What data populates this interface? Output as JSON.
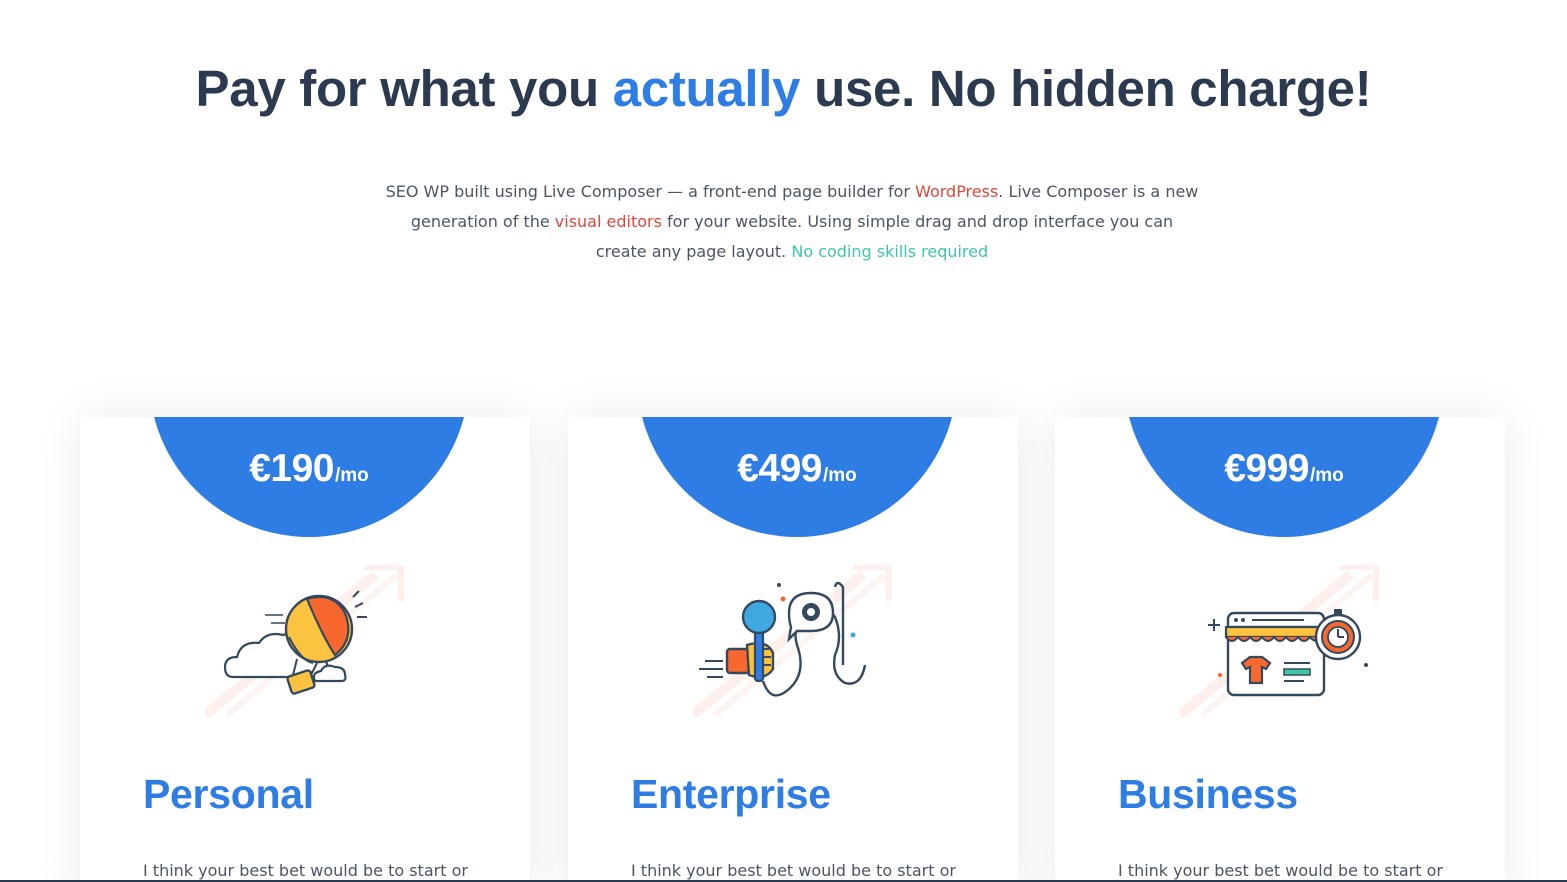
{
  "header": {
    "title_before": "Pay for what you",
    "title_accent": "actually",
    "title_after": "use. No hidden charge!"
  },
  "intro": {
    "part1": "SEO WP built using Live Composer — a front-end page builder for ",
    "link1": "WordPress",
    "part2": ". Live Composer is a new generation of the ",
    "link2": "visual editors",
    "part3": " for your website. Using simple drag and drop interface you can create any page layout. ",
    "link3": "No coding skills required"
  },
  "plans": [
    {
      "price": "€190",
      "period": "/mo",
      "name": "Personal",
      "illustration": "hot-air-balloon-illustration",
      "description": "I think your best bet would be to start or"
    },
    {
      "price": "€499",
      "period": "/mo",
      "name": "Enterprise",
      "illustration": "microphone-speech-illustration",
      "description": "I think your best bet would be to start or"
    },
    {
      "price": "€999",
      "period": "/mo",
      "name": "Business",
      "illustration": "online-store-clock-illustration",
      "description": "I think your best bet would be to start or"
    }
  ],
  "colors": {
    "accent": "#2d7de5",
    "heading": "#2b3a4f",
    "body_text": "#4b5566",
    "link_red": "#e0443a",
    "link_teal": "#3fc5a8",
    "illustration_orange": "#f7672e",
    "illustration_yellow": "#fbc33f"
  }
}
